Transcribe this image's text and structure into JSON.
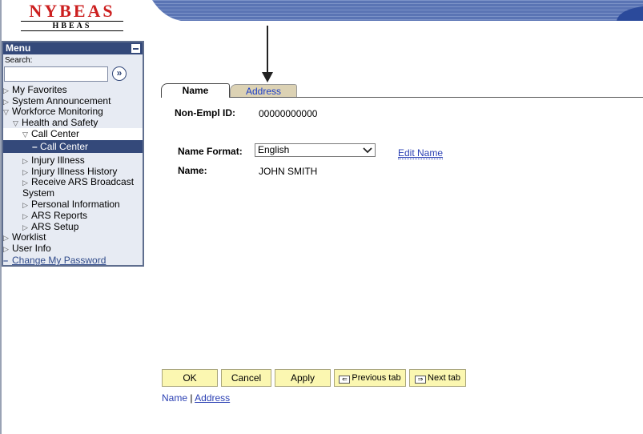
{
  "header": {
    "logo_main": "NYBEAS",
    "logo_sub": "HBEAS"
  },
  "menu": {
    "title": "Menu",
    "search_label": "Search:",
    "search_value": "",
    "items": [
      {
        "label": "My Favorites"
      },
      {
        "label": "System Announcement"
      },
      {
        "label": "Workforce Monitoring"
      },
      {
        "label": "Health and Safety"
      },
      {
        "label": "Call Center"
      },
      {
        "label": "Call Center"
      },
      {
        "label": "Injury Illness"
      },
      {
        "label": "Injury Illness History"
      },
      {
        "label": "Receive ARS Broadcast"
      },
      {
        "label": "System"
      },
      {
        "label": "Personal Information"
      },
      {
        "label": "ARS Reports"
      },
      {
        "label": "ARS Setup"
      },
      {
        "label": "Worklist"
      },
      {
        "label": "User Info"
      },
      {
        "label": "Change My Password"
      }
    ]
  },
  "tabs": {
    "name": "Name",
    "address": "Address"
  },
  "form": {
    "empl_id_label": "Non-Empl ID:",
    "empl_id_value": "00000000000",
    "name_format_label": "Name Format:",
    "name_format_value": "English",
    "edit_name": "Edit Name",
    "name_label": "Name:",
    "name_value": "JOHN SMITH"
  },
  "buttons": {
    "ok": "OK",
    "cancel": "Cancel",
    "apply": "Apply",
    "previous_tab": "Previous tab",
    "next_tab": "Next tab"
  },
  "bottom_links": {
    "name": "Name",
    "separator": " | ",
    "address": "Address"
  },
  "colors": {
    "menu_header": "#34497a",
    "button_bg": "#fbf7b1",
    "link": "#2a3fb3",
    "inactive_tab": "#dcd2b4",
    "logo_red": "#cc1f1f"
  }
}
